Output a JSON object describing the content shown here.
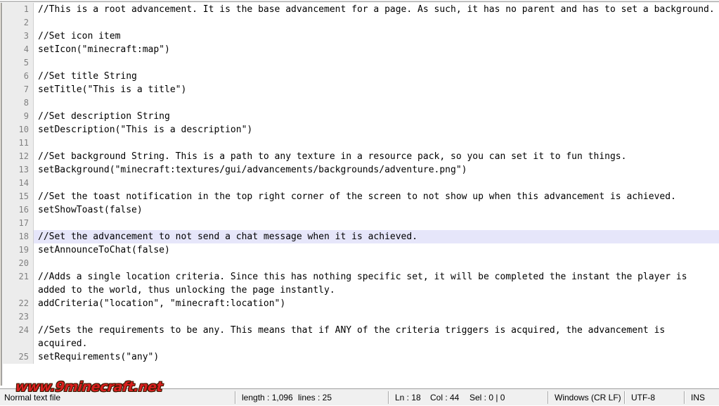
{
  "window": {
    "app": "Notepad++"
  },
  "editor": {
    "current_line": 18,
    "highlight_color": "#e6e6fa",
    "gutter_bg": "#ececec",
    "lines": [
      {
        "n": "1",
        "text": "//This is a root advancement. It is the base advancement for a page. As such, it has no parent and has to set a background."
      },
      {
        "n": "2",
        "text": ""
      },
      {
        "n": "3",
        "text": "//Set icon item"
      },
      {
        "n": "4",
        "text": "setIcon(\"minecraft:map\")"
      },
      {
        "n": "5",
        "text": ""
      },
      {
        "n": "6",
        "text": "//Set title String"
      },
      {
        "n": "7",
        "text": "setTitle(\"This is a title\")"
      },
      {
        "n": "8",
        "text": ""
      },
      {
        "n": "9",
        "text": "//Set description String"
      },
      {
        "n": "10",
        "text": "setDescription(\"This is a description\")"
      },
      {
        "n": "11",
        "text": ""
      },
      {
        "n": "12",
        "text": "//Set background String. This is a path to any texture in a resource pack, so you can set it to fun things."
      },
      {
        "n": "13",
        "text": "setBackground(\"minecraft:textures/gui/advancements/backgrounds/adventure.png\")"
      },
      {
        "n": "14",
        "text": ""
      },
      {
        "n": "15",
        "text": "//Set the toast notification in the top right corner of the screen to not show up when this advancement is achieved."
      },
      {
        "n": "16",
        "text": "setShowToast(false)"
      },
      {
        "n": "17",
        "text": ""
      },
      {
        "n": "18",
        "text": "//Set the advancement to not send a chat message when it is achieved."
      },
      {
        "n": "19",
        "text": "setAnnounceToChat(false)"
      },
      {
        "n": "20",
        "text": ""
      },
      {
        "n": "21",
        "text": "//Adds a single location criteria. Since this has nothing specific set, it will be completed the instant the player is added to the world, thus unlocking the page instantly."
      },
      {
        "n": "22",
        "text": "addCriteria(\"location\", \"minecraft:location\")"
      },
      {
        "n": "23",
        "text": ""
      },
      {
        "n": "24",
        "text": "//Sets the requirements to be any. This means that if ANY of the criteria triggers is acquired, the advancement is acquired."
      },
      {
        "n": "25",
        "text": "setRequirements(\"any\")"
      }
    ]
  },
  "watermark": {
    "text": "www.9minecraft.net",
    "color": "#d81f1f"
  },
  "statusbar": {
    "file_type": "Normal text file",
    "length": "length : 1,096",
    "lines": "lines : 25",
    "ln": "Ln : 18",
    "col": "Col : 44",
    "sel": "Sel : 0 | 0",
    "eol": "Windows (CR LF)",
    "encoding": "UTF-8",
    "insert_mode": "INS"
  }
}
